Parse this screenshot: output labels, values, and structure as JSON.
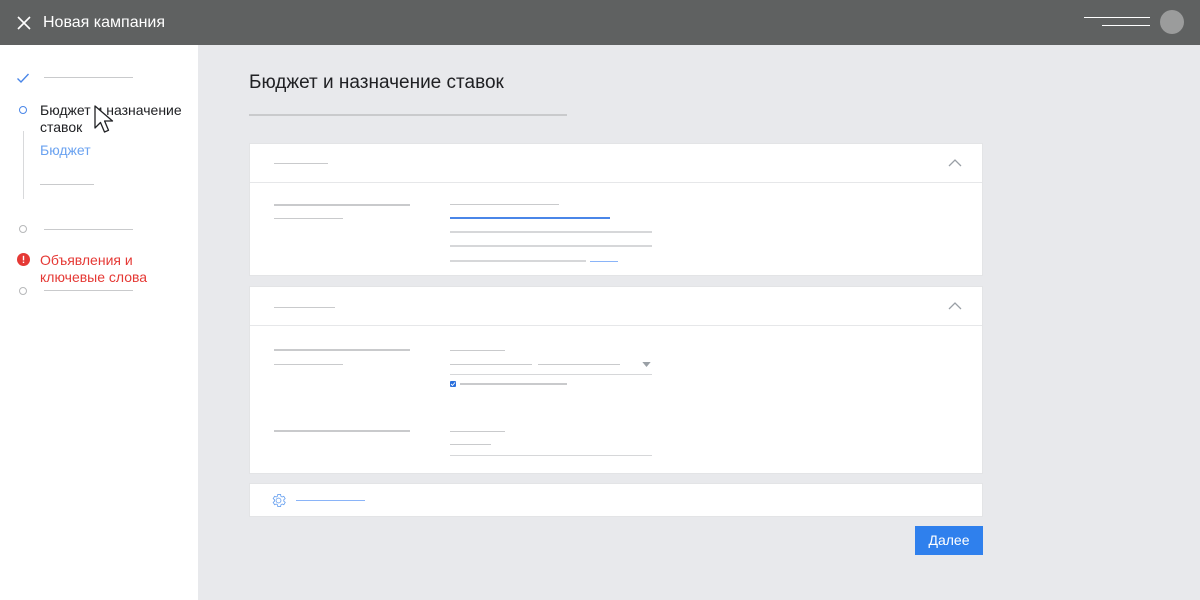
{
  "header": {
    "title": "Новая кампания"
  },
  "sidebar": {
    "steps": [
      {
        "label": "",
        "state": "done"
      },
      {
        "label": "Бюджет и назначение ставок",
        "state": "current",
        "substep": "Бюджет"
      },
      {
        "label": "",
        "state": "pending"
      },
      {
        "label": "Объявления и ключевые слова",
        "state": "error"
      },
      {
        "label": "",
        "state": "pending"
      }
    ]
  },
  "main": {
    "page_title": "Бюджет и назначение ставок",
    "next_label": "Далее"
  },
  "colors": {
    "topbar": "#5f6161",
    "accent": "#2f80ed",
    "error": "#e53935",
    "link": "#6aa2f0"
  },
  "icons": [
    "close-icon",
    "checkmark-icon",
    "circle-icon",
    "error-icon",
    "chevron-up-icon",
    "gear-icon",
    "checkbox-icon",
    "dropdown-arrow-icon",
    "cursor-icon"
  ]
}
